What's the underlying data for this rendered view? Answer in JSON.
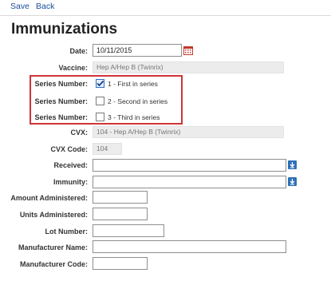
{
  "toolbar": {
    "save_label": "Save",
    "back_label": "Back"
  },
  "page": {
    "title": "Immunizations"
  },
  "form": {
    "date": {
      "label": "Date:",
      "value": "10/11/2015"
    },
    "vaccine": {
      "label": "Vaccine:",
      "value": "Hep A/Hep B (Twinrix)"
    },
    "series": {
      "label": "Series Number:",
      "options": [
        {
          "label": "1 - First in series",
          "checked": true
        },
        {
          "label": "2 - Second in series",
          "checked": false
        },
        {
          "label": "3 - Third in series",
          "checked": false
        }
      ]
    },
    "cvx": {
      "label": "CVX:",
      "value": "104 - Hep A/Hep B (Twinrix)"
    },
    "cvx_code": {
      "label": "CVX Code:",
      "value": "104"
    },
    "received": {
      "label": "Received:",
      "value": ""
    },
    "immunity": {
      "label": "Immunity:",
      "value": ""
    },
    "amount": {
      "label": "Amount Administered:",
      "value": ""
    },
    "units": {
      "label": "Units Administered:",
      "value": ""
    },
    "lot": {
      "label": "Lot Number:",
      "value": ""
    },
    "manufacturer_name": {
      "label": "Manufacturer Name:",
      "value": ""
    },
    "manufacturer_code": {
      "label": "Manufacturer Code:",
      "value": ""
    }
  },
  "icons": {
    "calendar": "calendar-icon",
    "dropdown": "download-arrow-icon"
  },
  "colors": {
    "highlight": "#d0343a",
    "link": "#1a4e9a",
    "dropdown_button": "#2d6fb6"
  }
}
